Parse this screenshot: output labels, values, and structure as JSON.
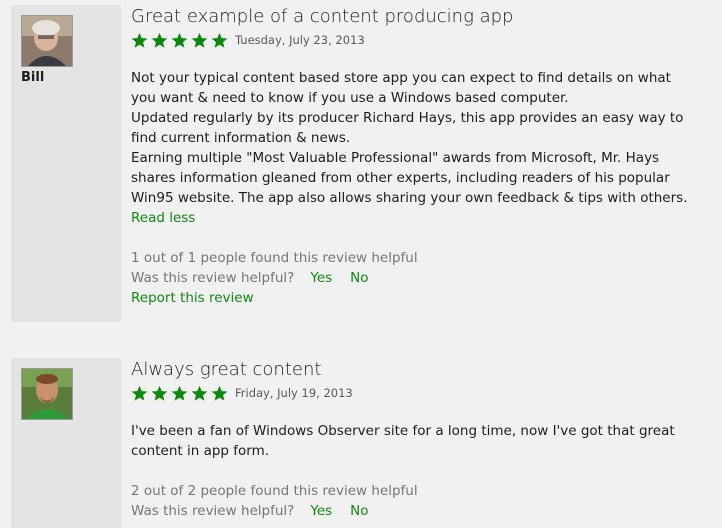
{
  "reviews": [
    {
      "author": "Bill",
      "title": "Great example of a content producing app",
      "rating": 5,
      "date": "Tuesday, July 23, 2013",
      "body": [
        "Not your typical content based store app you can expect to find details on what you want & need to know if you use a Windows based computer.",
        "Updated regularly by its  producer Richard Hays, this app provides an easy way to find current information & news.",
        "Earning multiple  \"Most Valuable Professional\" awards from Microsoft, Mr. Hays shares information gleaned from other experts, including readers of his popular Win95 website. The app also allows sharing your own feedback & tips with others."
      ],
      "read_less": "Read less",
      "helpful_count": "1 out of 1 people found this review helpful",
      "helpful_question": "Was this review helpful?",
      "yes": "Yes",
      "no": "No",
      "report": "Report this review"
    },
    {
      "title": "Always great content",
      "rating": 5,
      "date": "Friday, July 19, 2013",
      "body": [
        "I've been a fan of Windows Observer site for a long time, now I've got that great content in app form."
      ],
      "helpful_count": "2 out of 2 people found this review helpful",
      "helpful_question": "Was this review helpful?",
      "yes": "Yes",
      "no": "No"
    }
  ],
  "colors": {
    "accent": "#108a10",
    "star": "#0a8a0a",
    "panel": "#e4e4e4",
    "background": "#f1f1f1"
  },
  "icons": {
    "star": "star-icon"
  }
}
